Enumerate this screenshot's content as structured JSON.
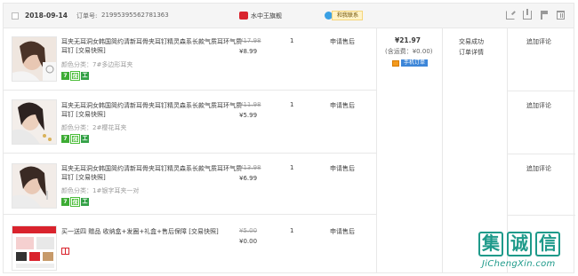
{
  "header": {
    "date": "2018-09-14",
    "order_label": "订单号:",
    "order_number": "219953955627813​63",
    "shop_name": "水中王旗舰",
    "contact_label": "和我联系",
    "icons": [
      "share-icon",
      "upload-icon",
      "flag-icon",
      "trash-icon"
    ]
  },
  "items": [
    {
      "title": "耳夹无耳洞女韩国简约清新耳骨夹耳钉精灵森系长款气质耳环气质耳钉 [交易快照]",
      "sku": "颜色分类：7#多边形耳夹",
      "price_old": "¥17.98",
      "price_new": "¥8.99",
      "qty": "1",
      "refund": "申请售后",
      "action": "追加评论"
    },
    {
      "title": "耳夹无耳洞女韩国简约清新耳骨夹耳钉精灵森系长款气质耳环气质耳钉 [交易快照]",
      "sku": "颜色分类：2#樱花耳夹",
      "price_old": "¥11.98",
      "price_new": "¥5.99",
      "qty": "1",
      "refund": "申请售后",
      "action": "追加评论"
    },
    {
      "title": "耳夹无耳洞女韩国简约清新耳骨夹耳钉精灵森系长款气质耳环气质耳钉 [交易快照]",
      "sku": "颜色分类：1#银字耳夹一对",
      "price_old": "¥13.98",
      "price_new": "¥6.99",
      "qty": "1",
      "refund": "申请售后",
      "action": "追加评论"
    },
    {
      "title": "买一送四 赠品 收纳盒+发圈+礼盒+售后保障 [交易快照]",
      "sku": "",
      "price_old": "¥5.00",
      "price_new": "¥0.00",
      "qty": "1",
      "refund": "申请售后",
      "action": ""
    }
  ],
  "tags": [
    "7",
    "保",
    "工"
  ],
  "summary": {
    "total": "¥21.97",
    "shipping": "(含运费：¥0.00)",
    "pay_label": "手机订单",
    "status": "交易成功",
    "detail": "订单详情"
  },
  "watermark": {
    "cn": [
      "集",
      "诚",
      "信"
    ],
    "en": "JiChengXin.com"
  },
  "colors": {
    "header_bg": "#f5f5f5",
    "border": "#e8e8e8",
    "tag_green": "#3dac34",
    "brand_red": "#d9232d",
    "watermark": "#1e9a8a"
  }
}
